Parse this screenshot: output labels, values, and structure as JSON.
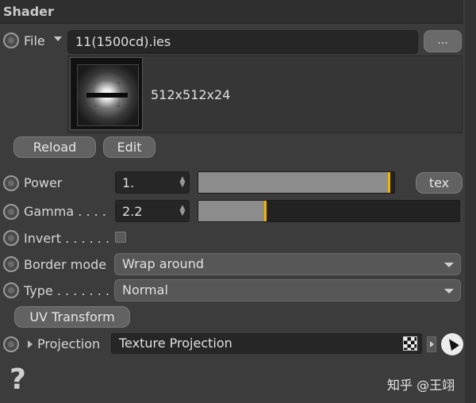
{
  "header": {
    "title": "Shader"
  },
  "file": {
    "label": "File",
    "value": "11(1500cd).ies",
    "browse_label": "..."
  },
  "preview": {
    "resolution": "512x512x24"
  },
  "buttons": {
    "reload": "Reload",
    "edit": "Edit",
    "tex": "tex",
    "uv_transform": "UV Transform"
  },
  "power": {
    "label": "Power",
    "value": "1.",
    "slider_fraction": 0.98
  },
  "gamma": {
    "label": "Gamma . . . .",
    "value": "2.2",
    "slider_fraction": 0.26
  },
  "invert": {
    "label": "Invert . . . . . .",
    "checked": false
  },
  "border_mode": {
    "label": "Border mode",
    "value": "Wrap around"
  },
  "type": {
    "label": "Type . . . . . . .",
    "value": "Normal"
  },
  "projection": {
    "label": "Projection",
    "value": "Texture Projection"
  },
  "help": {
    "glyph": "?"
  },
  "watermark": {
    "text": "知乎 @王翊"
  },
  "colors": {
    "accent_handle": "#f0b400",
    "field_bg": "#262626",
    "panel_bg": "#3c3c3c"
  }
}
